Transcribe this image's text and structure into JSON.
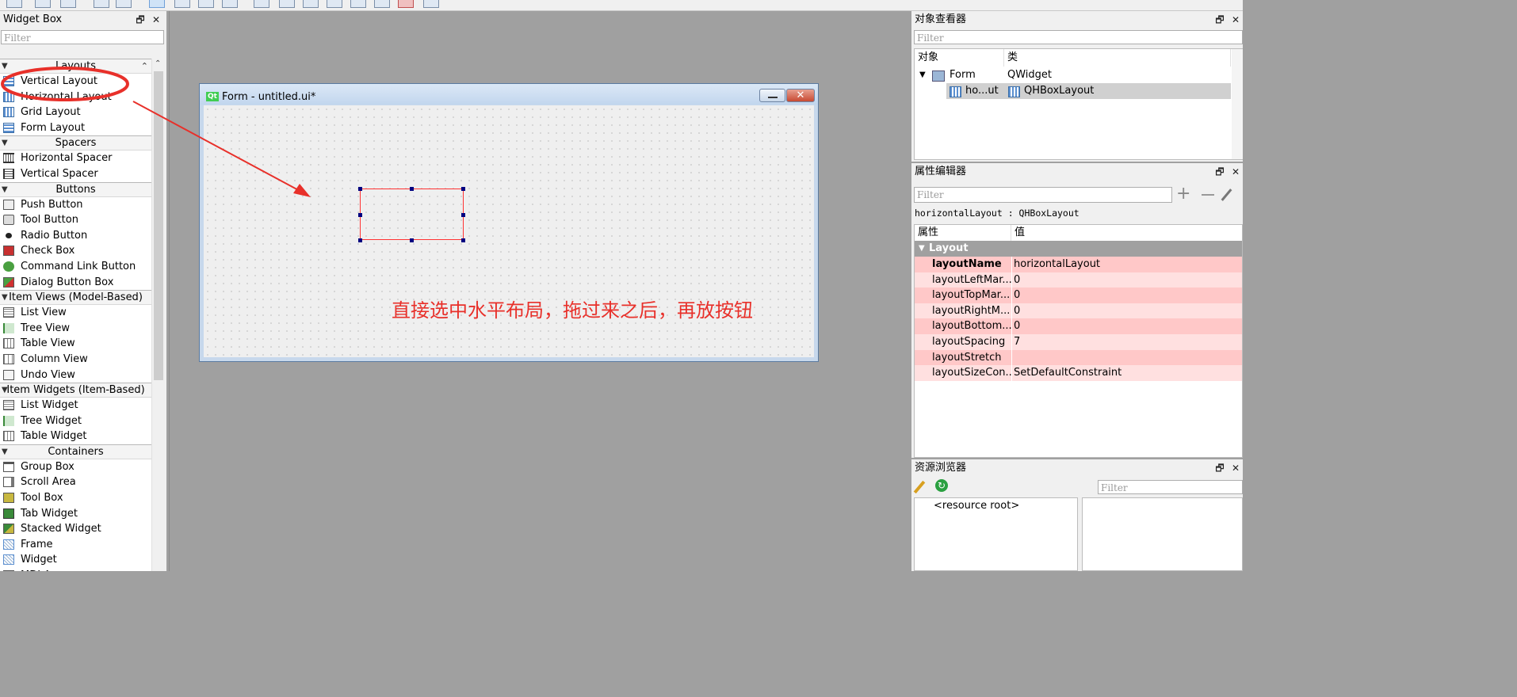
{
  "widget_box": {
    "title": "Widget Box",
    "filter_placeholder": "Filter",
    "categories": [
      {
        "label": "Layouts",
        "items": [
          "Vertical Layout",
          "Horizontal Layout",
          "Grid Layout",
          "Form Layout"
        ]
      },
      {
        "label": "Spacers",
        "items": [
          "Horizontal Spacer",
          "Vertical Spacer"
        ]
      },
      {
        "label": "Buttons",
        "items": [
          "Push Button",
          "Tool Button",
          "Radio Button",
          "Check Box",
          "Command Link Button",
          "Dialog Button Box"
        ]
      },
      {
        "label": "Item Views (Model-Based)",
        "items": [
          "List View",
          "Tree View",
          "Table View",
          "Column View",
          "Undo View"
        ]
      },
      {
        "label": "Item Widgets (Item-Based)",
        "items": [
          "List Widget",
          "Tree Widget",
          "Table Widget"
        ]
      },
      {
        "label": "Containers",
        "items": [
          "Group Box",
          "Scroll Area",
          "Tool Box",
          "Tab Widget",
          "Stacked Widget",
          "Frame",
          "Widget",
          "MDI Area"
        ]
      }
    ]
  },
  "form_window": {
    "title": "Form - untitled.ui*",
    "logo_text": "Qt",
    "close_glyph": "✕"
  },
  "annotation": {
    "text": "直接选中水平布局，拖过来之后，再放按钮",
    "color": "#e8302a"
  },
  "object_inspector": {
    "title": "对象查看器",
    "filter_placeholder": "Filter",
    "col_object": "对象",
    "col_class": "类",
    "rows": [
      {
        "object": "Form",
        "class": "QWidget"
      },
      {
        "object": "ho...ut",
        "class": "QHBoxLayout"
      }
    ]
  },
  "property_editor": {
    "title": "属性编辑器",
    "filter_placeholder": "Filter",
    "object_line": "horizontalLayout : QHBoxLayout",
    "col_property": "属性",
    "col_value": "值",
    "group": "Layout",
    "properties": [
      {
        "name": "layoutName",
        "value": "horizontalLayout"
      },
      {
        "name": "layoutLeftMar...",
        "value": "0"
      },
      {
        "name": "layoutTopMar...",
        "value": "0"
      },
      {
        "name": "layoutRightM...",
        "value": "0"
      },
      {
        "name": "layoutBottom...",
        "value": "0"
      },
      {
        "name": "layoutSpacing",
        "value": "7"
      },
      {
        "name": "layoutStretch",
        "value": ""
      },
      {
        "name": "layoutSizeCon...",
        "value": "SetDefaultConstraint"
      }
    ]
  },
  "resource_browser": {
    "title": "资源浏览器",
    "filter_placeholder": "Filter",
    "root_label": "<resource root>"
  },
  "dock_buttons": {
    "float": "🗗",
    "close": "✕"
  },
  "colors": {
    "highlight_red": "#e8302a",
    "property_row_pink": "#ffc8c8",
    "property_row_pink_light": "#ffe0e0",
    "group_header": "#a0a0a0",
    "selection": "#d0d0d0"
  }
}
